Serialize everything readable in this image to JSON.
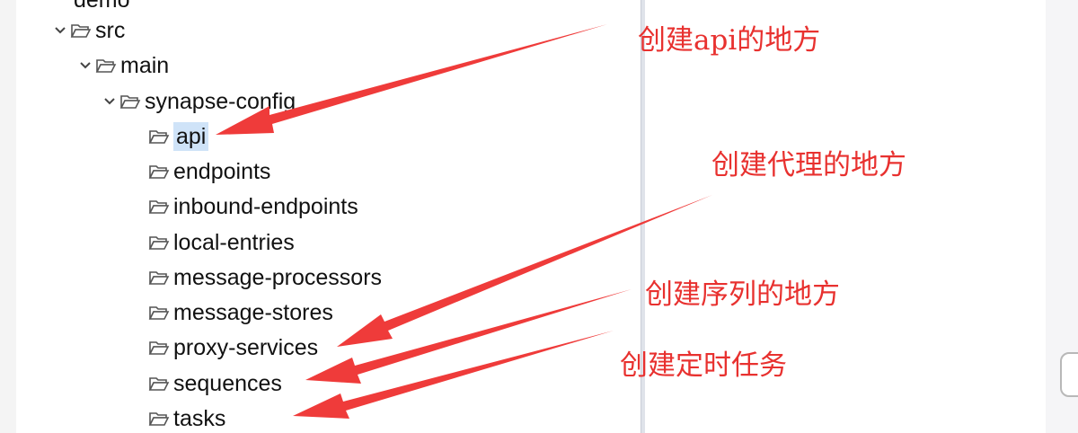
{
  "tree": {
    "top_cut": "demo",
    "src": "src",
    "main": "main",
    "synapse": "synapse-config",
    "children": [
      {
        "label": "api",
        "selected": true
      },
      {
        "label": "endpoints"
      },
      {
        "label": "inbound-endpoints"
      },
      {
        "label": "local-entries"
      },
      {
        "label": "message-processors"
      },
      {
        "label": "message-stores"
      },
      {
        "label": "proxy-services"
      },
      {
        "label": "sequences"
      },
      {
        "label": "tasks"
      }
    ]
  },
  "annotations": {
    "api": "创建api的地方",
    "proxy": "创建代理的地方",
    "sequence": "创建序列的地方",
    "task": "创建定时任务"
  },
  "colors": {
    "annotation": "#e8312f",
    "selection": "#cfe3f8"
  },
  "icons": {
    "expander": "chevron-down-icon",
    "folder": "open-folder-icon"
  }
}
